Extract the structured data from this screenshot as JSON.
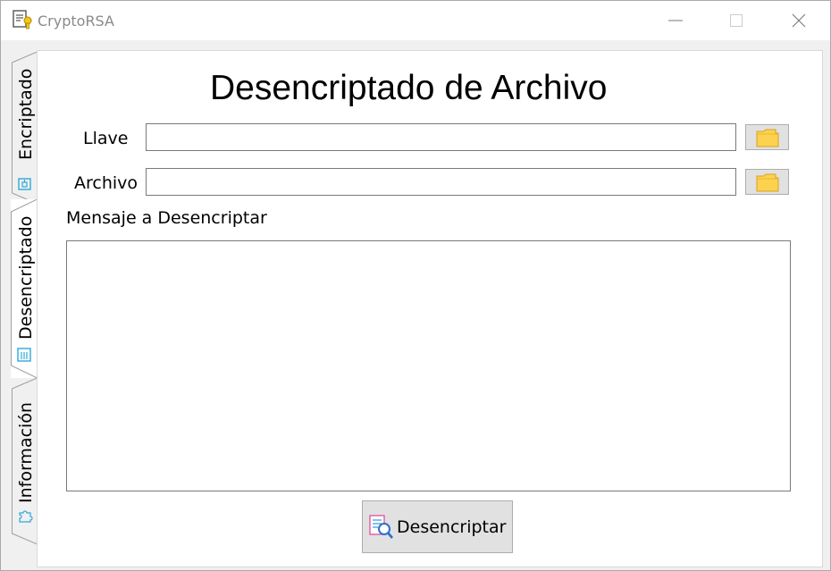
{
  "window": {
    "title": "CryptoRSA",
    "controls": {
      "minimize": "minimize-icon",
      "maximize": "maximize-icon",
      "close": "close-icon"
    }
  },
  "tabs": [
    {
      "label": "Encriptado",
      "icon": "lock-document-icon",
      "selected": false
    },
    {
      "label": "Desencriptado",
      "icon": "document-list-icon",
      "selected": true
    },
    {
      "label": "Información",
      "icon": "puzzle-icon",
      "selected": false
    }
  ],
  "page": {
    "title": "Desencriptado de Archivo",
    "key_label": "Llave",
    "key_value": "",
    "file_label": "Archivo",
    "file_value": "",
    "message_label": "Mensaje a Desencriptar",
    "message_value": "",
    "decrypt_button_label": "Desencriptar"
  },
  "colors": {
    "folder_fill": "#fcd24f",
    "folder_edge": "#d9a320",
    "tab_icon": "#2ea8d8",
    "button_bg": "#e1e1e1"
  }
}
